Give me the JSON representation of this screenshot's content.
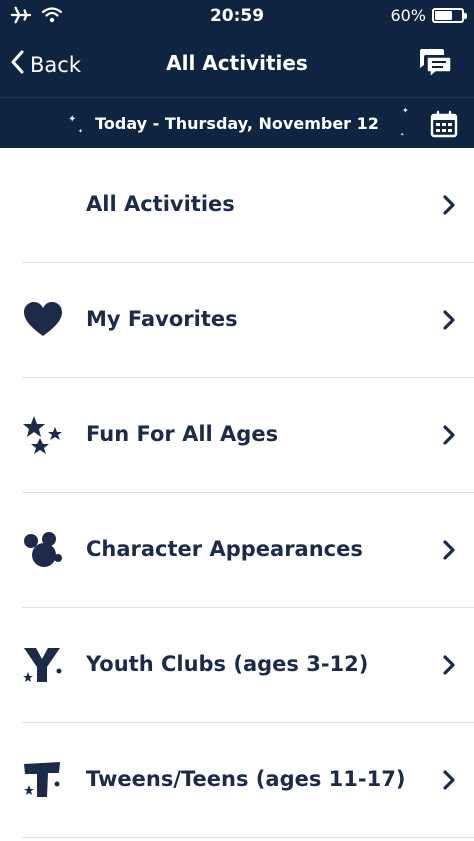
{
  "status_bar": {
    "time": "20:59",
    "battery": "60%",
    "battery_level": 0.6,
    "icons": [
      "airplane-icon",
      "wifi-icon",
      "battery-icon"
    ]
  },
  "nav": {
    "back_label": "Back",
    "title": "All Activities",
    "chat_icon": "chat-bubble-icon"
  },
  "date_bar": {
    "label": "Today - Thursday, November 12",
    "calendar_icon": "calendar-icon"
  },
  "list": {
    "items": [
      {
        "label": "All Activities",
        "icon": "none"
      },
      {
        "label": "My Favorites",
        "icon": "heart-icon"
      },
      {
        "label": "Fun For All Ages",
        "icon": "stars-icon"
      },
      {
        "label": "Character Appearances",
        "icon": "mickey-ears-icon"
      },
      {
        "label": "Youth Clubs (ages 3-12)",
        "icon": "youth-club-y-icon"
      },
      {
        "label": "Tweens/Teens (ages 11-17)",
        "icon": "tweens-t-icon"
      }
    ]
  },
  "colors": {
    "header_bg": "#0e2440",
    "text_navy": "#1d2b4a",
    "separator": "#e2e2e2"
  }
}
